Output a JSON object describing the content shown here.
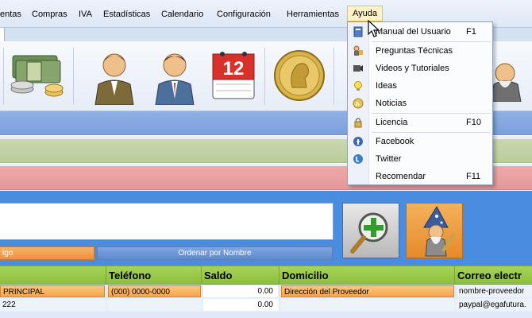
{
  "menubar": {
    "items": [
      {
        "label": "entas"
      },
      {
        "label": "Compras"
      },
      {
        "label": "IVA"
      },
      {
        "label": "Estadísticas"
      },
      {
        "label": "Calendario"
      },
      {
        "label": "Configuración"
      },
      {
        "label": "Herramientas"
      },
      {
        "label": "Ayuda"
      }
    ]
  },
  "toolbar": {
    "icons": [
      "money-icon",
      "client-icon",
      "supplier-icon",
      "calendar-icon",
      "coin-icon",
      "wizard-icon"
    ],
    "calendar_day": "12"
  },
  "help_menu": {
    "items": [
      {
        "label": "Manual del Usuario",
        "shortcut": "F1",
        "icon": "book-icon"
      },
      {
        "label": "Preguntas Técnicas",
        "shortcut": "",
        "icon": "faq-icon"
      },
      {
        "label": "Videos y Tutoriales",
        "shortcut": "",
        "icon": "video-icon"
      },
      {
        "label": "Ideas",
        "shortcut": "",
        "icon": "lightbulb-icon"
      },
      {
        "label": "Noticias",
        "shortcut": "",
        "icon": "rss-icon"
      },
      {
        "label": "Licencia",
        "shortcut": "F10",
        "icon": "license-icon"
      },
      {
        "label": "Facebook",
        "shortcut": "",
        "icon": "facebook-icon"
      },
      {
        "label": "Twitter",
        "shortcut": "",
        "icon": "twitter-icon"
      },
      {
        "label": "Recomendar",
        "shortcut": "F11",
        "icon": "recommend-icon"
      }
    ]
  },
  "search": {
    "sort_by_code": "igo",
    "sort_by_name": "Ordenar por Nombre"
  },
  "grid": {
    "columns": [
      "",
      "Teléfono",
      "Saldo",
      "Domicilio",
      "Correo electr"
    ],
    "rows": [
      [
        "PRINCIPAL",
        "(000) 0000-0000",
        "0.00",
        "Dirección del Proveedor",
        "nombre-proveedor"
      ],
      [
        "222",
        "",
        "0.00",
        "",
        "paypal@egafutura."
      ]
    ]
  },
  "colors": {
    "accent_blue": "#4a8ce0",
    "grid_header_green": "#8cbf3b",
    "highlight_orange": "#f4a44c",
    "menu_hover": "#fdf3c7"
  }
}
